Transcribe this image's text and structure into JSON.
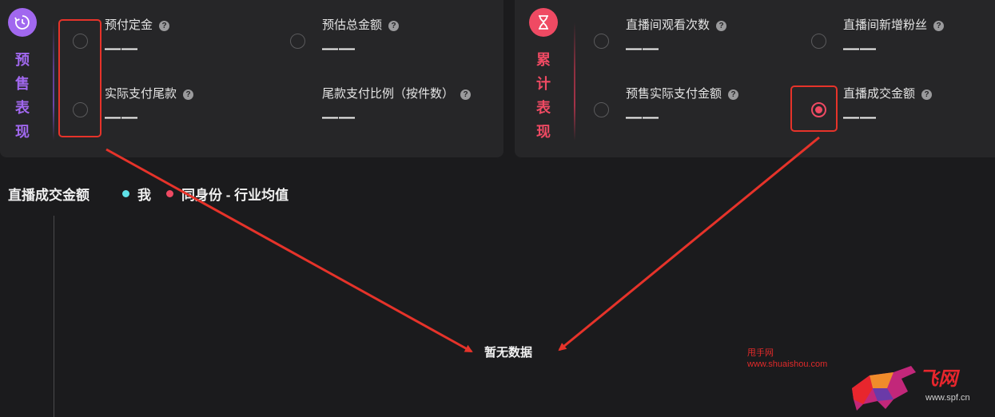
{
  "presale": {
    "label": "预售表现",
    "icon": "clock-refresh-icon",
    "accent": "#a168ef",
    "metrics": [
      {
        "name": "预付定金",
        "value": "——",
        "selected": false
      },
      {
        "name": "预估总金额",
        "value": "——",
        "selected": false
      },
      {
        "name": "实际支付尾款",
        "value": "——",
        "selected": false
      },
      {
        "name": "尾款支付比例（按件数）",
        "value": "——",
        "selected": false
      }
    ]
  },
  "cumulative": {
    "label": "累计表现",
    "icon": "hourglass-icon",
    "accent": "#ef4a63",
    "metrics": [
      {
        "name": "直播间观看次数",
        "value": "——",
        "selected": false
      },
      {
        "name": "直播间新增粉丝",
        "value": "——",
        "selected": false
      },
      {
        "name": "预售实际支付金额",
        "value": "——",
        "selected": false
      },
      {
        "name": "直播成交金额",
        "value": "——",
        "selected": true
      }
    ]
  },
  "chart": {
    "title": "直播成交金额",
    "legend": [
      {
        "name": "我",
        "color": "#5fe1e8"
      },
      {
        "name": "同身份 - 行业均值",
        "color": "#ef4a63"
      }
    ],
    "empty_text": "暂无数据"
  },
  "watermark": {
    "site_cn": "甩手网",
    "site_url": "www.shuaishou.com",
    "logo_text": "飞网",
    "logo_url": "www.spf.cn"
  },
  "annotation_color": "#e6332a"
}
